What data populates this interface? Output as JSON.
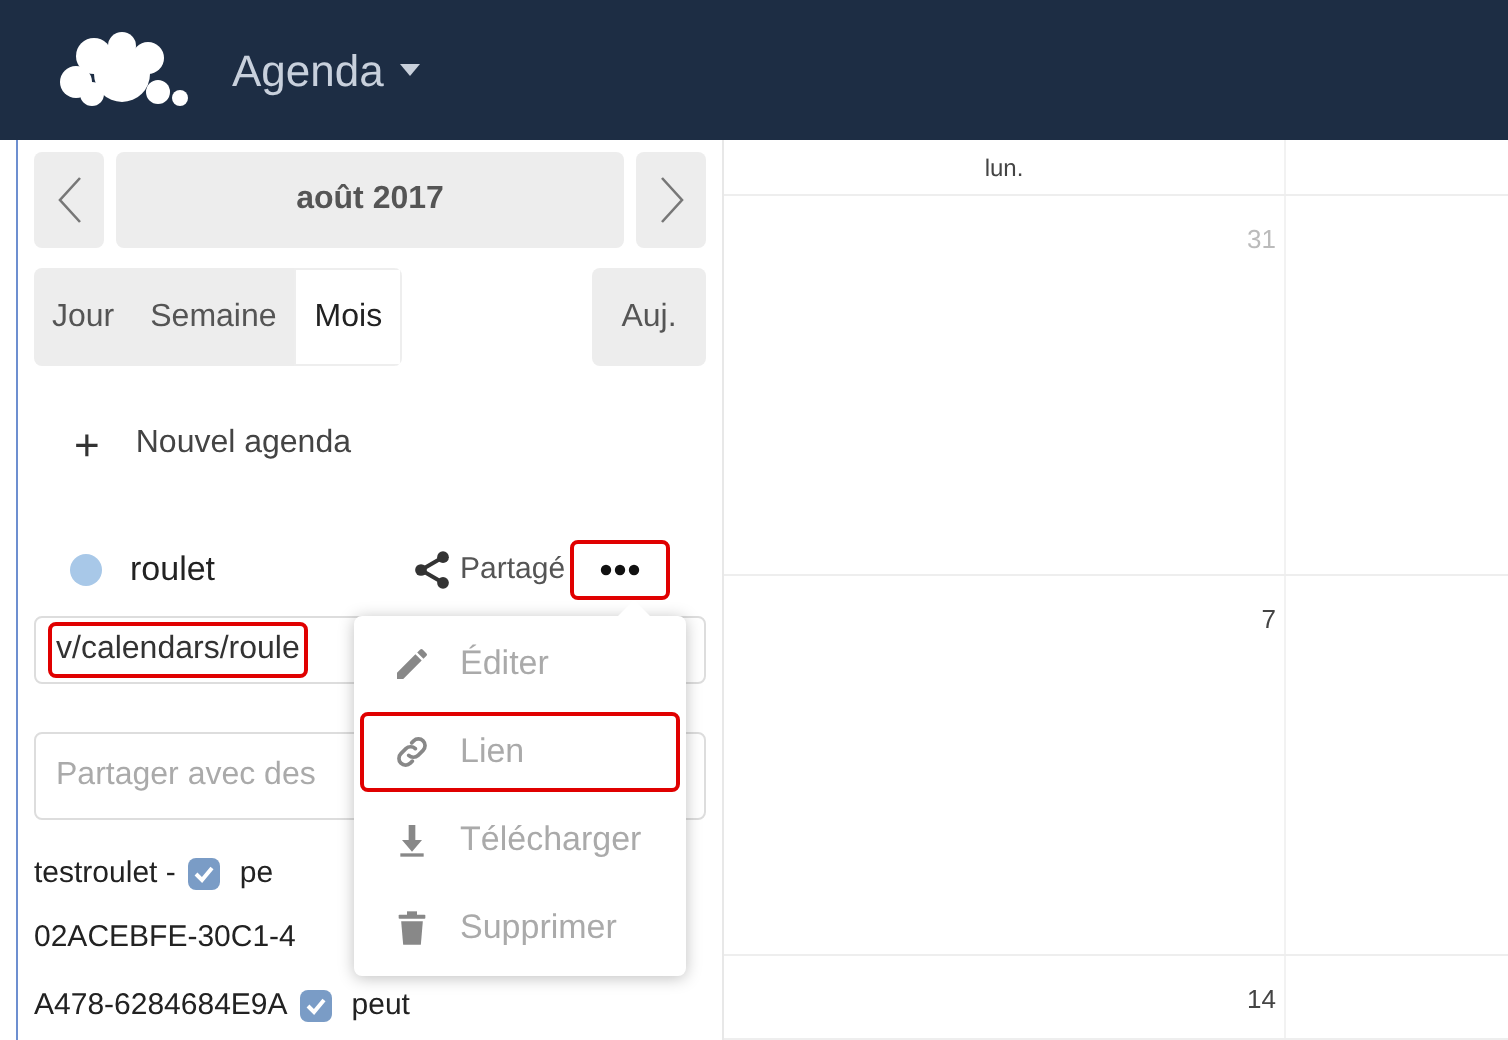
{
  "header": {
    "app_title": "Agenda"
  },
  "navigation": {
    "month": "août 2017"
  },
  "views": [
    {
      "label": "Jour",
      "selected": false
    },
    {
      "label": "Semaine",
      "selected": false
    },
    {
      "label": "Mois",
      "selected": true
    }
  ],
  "today_button": "Auj.",
  "new_calendar": {
    "icon": "+",
    "label": "Nouvel agenda"
  },
  "calendar": {
    "name": "roulet",
    "color": "#a8c8e8",
    "share_label": "Partagé",
    "more_highlighted": true
  },
  "link_field": {
    "value": "v/calendars/roule",
    "highlighted": true
  },
  "share_field": {
    "placeholder": "Partager avec des"
  },
  "shares": [
    {
      "lines": [
        "testroulet - "
      ],
      "checked": true,
      "permission": "pe"
    },
    {
      "lines": [
        "02ACEBFE-30C1-4",
        "A478-6284684E9A"
      ],
      "checked": true,
      "permission": "peut"
    }
  ],
  "menu": [
    {
      "kind": "edit",
      "label": "Éditer",
      "highlighted": false
    },
    {
      "kind": "link",
      "label": "Lien",
      "highlighted": true
    },
    {
      "kind": "download",
      "label": "Télécharger",
      "highlighted": false
    },
    {
      "kind": "delete",
      "label": "Supprimer",
      "highlighted": false
    }
  ],
  "grid": {
    "columns": [
      "lun.",
      ""
    ],
    "weeks": [
      {
        "day": "31",
        "other_month": true
      },
      {
        "day": "7",
        "other_month": false
      },
      {
        "day": "14",
        "other_month": false
      }
    ]
  }
}
